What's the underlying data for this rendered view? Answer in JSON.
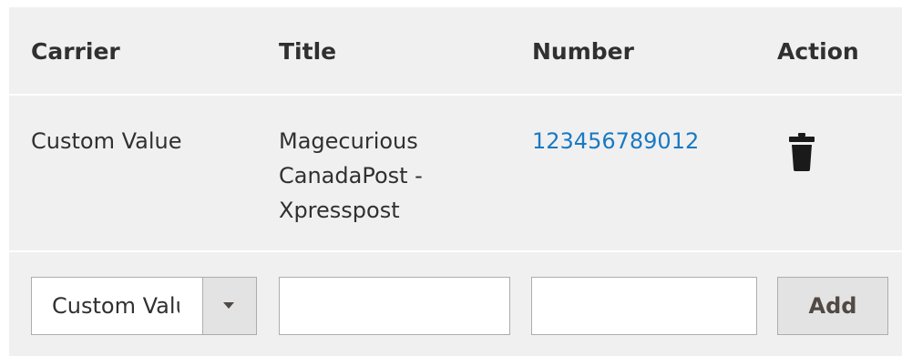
{
  "table": {
    "headers": {
      "carrier": "Carrier",
      "title": "Title",
      "number": "Number",
      "action": "Action"
    },
    "rows": [
      {
        "carrier": "Custom Value",
        "title_lines": [
          "Magecurious",
          "CanadaPost -",
          "Xpresspost"
        ],
        "number": "123456789012",
        "action_icon": "trash-icon"
      }
    ],
    "new_row": {
      "carrier_select_value": "Custom Value",
      "title_value": "",
      "number_value": "",
      "add_label": "Add"
    }
  },
  "colors": {
    "link": "#1979c3",
    "background": "#f0f0f0",
    "button_bg": "#e3e3e3"
  }
}
